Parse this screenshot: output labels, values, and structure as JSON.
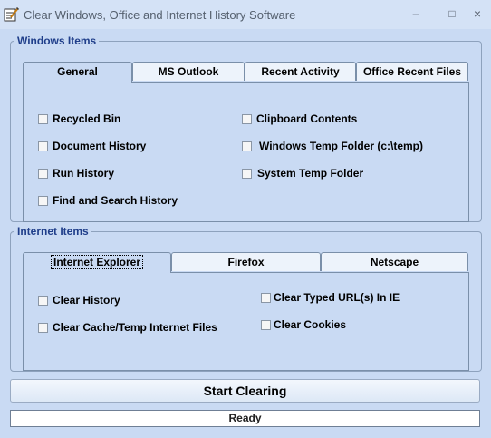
{
  "window": {
    "title": "Clear Windows, Office and Internet History Software",
    "icon": "broom-pencil-icon",
    "controls": {
      "minimize": "–",
      "maximize": "□",
      "close": "×"
    }
  },
  "windows_items": {
    "legend": "Windows Items",
    "tabs": [
      "General",
      "MS Outlook",
      "Recent Activity",
      "Office Recent Files"
    ],
    "active_tab": "General",
    "left_options": [
      "Recycled Bin",
      "Document History",
      "Run History",
      "Find and Search History"
    ],
    "right_options": [
      "Clipboard Contents",
      "Windows Temp Folder (c:\\temp)",
      "System Temp Folder"
    ]
  },
  "internet_items": {
    "legend": "Internet Items",
    "tabs": [
      "Internet Explorer",
      "Firefox",
      "Netscape"
    ],
    "active_tab": "Internet Explorer",
    "left_options": [
      "Clear History",
      "Clear Cache/Temp Internet Files"
    ],
    "right_options": [
      "Clear Typed URL(s) In IE",
      "Clear Cookies"
    ]
  },
  "actions": {
    "start_label": "Start Clearing"
  },
  "status": {
    "text": "Ready"
  },
  "colors": {
    "background": "#c9daf3",
    "legend": "#1f3e8a",
    "border": "#7a8fa9"
  }
}
